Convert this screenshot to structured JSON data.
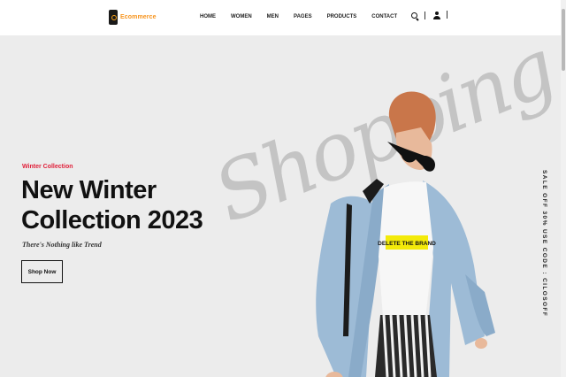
{
  "brand": {
    "name": "Ecommerce",
    "accent": "#f7941d"
  },
  "nav": {
    "items": [
      {
        "label": "HOME"
      },
      {
        "label": "WOMEN"
      },
      {
        "label": "MEN"
      },
      {
        "label": "PAGES"
      },
      {
        "label": "PRODUCTS"
      },
      {
        "label": "CONTACT"
      }
    ]
  },
  "header_icons": {
    "search": "search-icon",
    "account": "user-icon"
  },
  "hero": {
    "subtitle": "Winter Collection",
    "title": "New Winter Collection 2023",
    "tagline": "There's Nothing like Trend",
    "cta_label": "Shop Now",
    "watermark": "Shopping",
    "side_text": "SALE OFF 30% USE CODE : CILOSOFF",
    "model_shirt_text": "DELETE THE BRAND",
    "subtitle_color": "#e0203a"
  }
}
